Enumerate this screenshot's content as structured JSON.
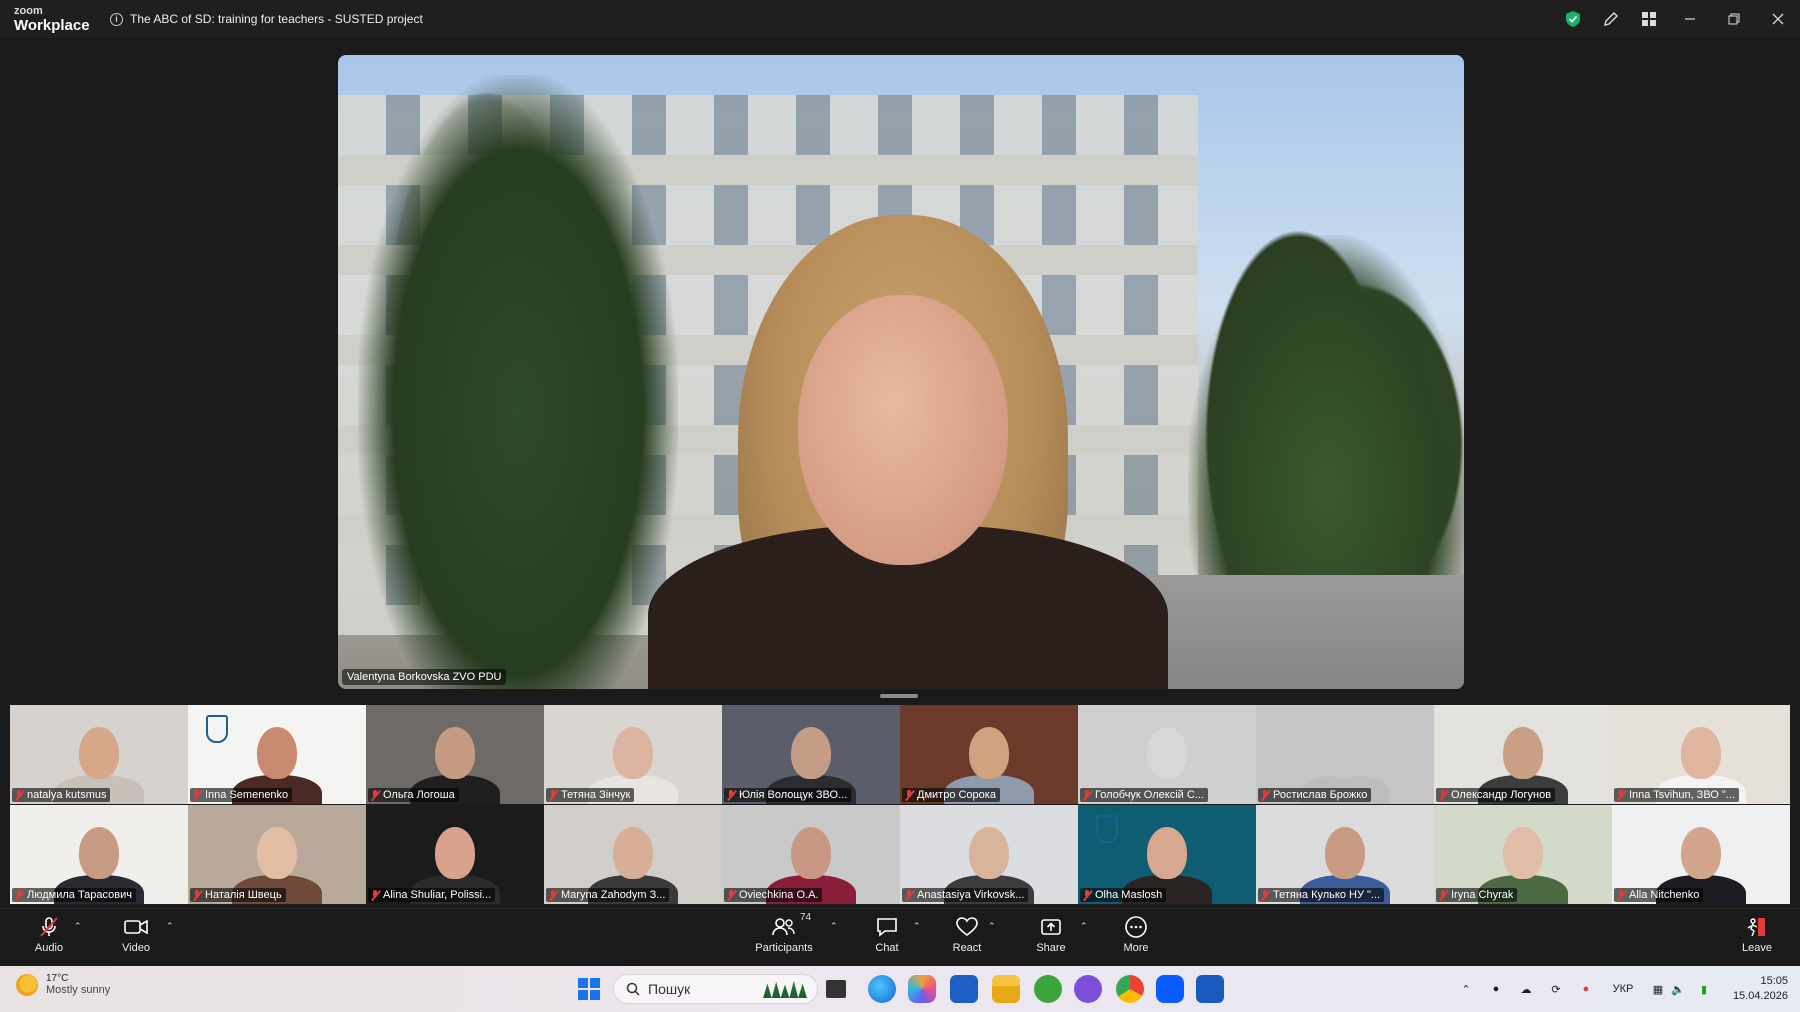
{
  "app": {
    "brand_top": "zoom",
    "brand_bottom": "Workplace",
    "meeting_title": "The ABC of SD: training for teachers - SUSTED project"
  },
  "main_speaker": {
    "name": "Valentyna Borkovska ZVO PDU"
  },
  "participants": [
    {
      "name": "natalya kutsmus",
      "bg": "#d8d2cf",
      "skin": "#d6a889",
      "shirt": "#c9c0b8"
    },
    {
      "name": "Inna Semenenko",
      "bg": "#f4f4f2",
      "skin": "#c98a72",
      "shirt": "#4a2a22",
      "logo": true
    },
    {
      "name": "Ольга Логоша",
      "bg": "#6e6a66",
      "skin": "#c79a83",
      "shirt": "#1f1f1f"
    },
    {
      "name": "Тетяна Зінчук",
      "bg": "#d9d6d2",
      "skin": "#dcb4a0",
      "shirt": "#e8e5e1"
    },
    {
      "name": "Юлія Волощук ЗВО...",
      "bg": "#5a5e6a",
      "skin": "#c59c86",
      "shirt": "#2b2b31"
    },
    {
      "name": "Дмитро Сорока",
      "bg": "#6b3a2a",
      "skin": "#d0a27f",
      "shirt": "#8f9baa"
    },
    {
      "name": "Голобчук Олексій С...",
      "bg": "#cfcfcf",
      "skin": "#d7d7d7",
      "shirt": "#cfcfcf"
    },
    {
      "name": "Ростислав Брожко",
      "bg": "#c5c5c5",
      "skin": "#c5c5c5",
      "shirt": "#bdbdbd"
    },
    {
      "name": "Олександр Логунов",
      "bg": "#e3e2dc",
      "skin": "#c9a085",
      "shirt": "#3b3d3a"
    },
    {
      "name": "Inna Tsvihun, ЗВО \"...",
      "bg": "#e6e1d8",
      "skin": "#e0b6a0",
      "shirt": "#f3f3f3"
    },
    {
      "name": "Людмила Тарасович",
      "bg": "#f1efec",
      "skin": "#c79b85",
      "shirt": "#2a2a33"
    },
    {
      "name": "Наталія Швець",
      "bg": "#b9a99a",
      "skin": "#e1bea4",
      "shirt": "#6f4a3a"
    },
    {
      "name": "Alina Shuliar, Polissi...",
      "bg": "#1b1b1b",
      "skin": "#d8a28c",
      "shirt": "#2b2b2b"
    },
    {
      "name": "Maryna Zahodym З...",
      "bg": "#d2cfcb",
      "skin": "#d8ae98",
      "shirt": "#3a3a3a"
    },
    {
      "name": "Oviechkina O.A.",
      "bg": "#c9c9c9",
      "skin": "#c99884",
      "shirt": "#8a1d3a"
    },
    {
      "name": "Anastasiya Virkovsk...",
      "bg": "#dcdde0",
      "skin": "#d9b49c",
      "shirt": "#3c3c40"
    },
    {
      "name": "Olha Maslosh",
      "bg": "#0f5d72",
      "skin": "#d7a88f",
      "shirt": "#2a2422",
      "logo": true
    },
    {
      "name": "Тетяна Кулько НУ \"...",
      "bg": "#dcdcdc",
      "skin": "#c89b82",
      "shirt": "#3c5c9a"
    },
    {
      "name": "Iryna Chyrak",
      "bg": "#d3dac8",
      "skin": "#e2bda7",
      "shirt": "#4c6b43"
    },
    {
      "name": "Alla Nitchenko",
      "bg": "#eff0f2",
      "skin": "#d3a58d",
      "shirt": "#1c1c22"
    }
  ],
  "toolbar": {
    "audio": "Audio",
    "video": "Video",
    "participants": "Participants",
    "participants_count": "74",
    "chat": "Chat",
    "react": "React",
    "share": "Share",
    "more": "More",
    "leave": "Leave"
  },
  "taskbar": {
    "temperature": "17°C",
    "weather": "Mostly sunny",
    "search_placeholder": "Пошук",
    "language": "УКР",
    "time": "15:05",
    "date": "15.04.2026"
  },
  "colors": {
    "accent_green": "#18b26b",
    "mic_off_red": "#e23b3b",
    "zoom_blue": "#0b5cff"
  }
}
